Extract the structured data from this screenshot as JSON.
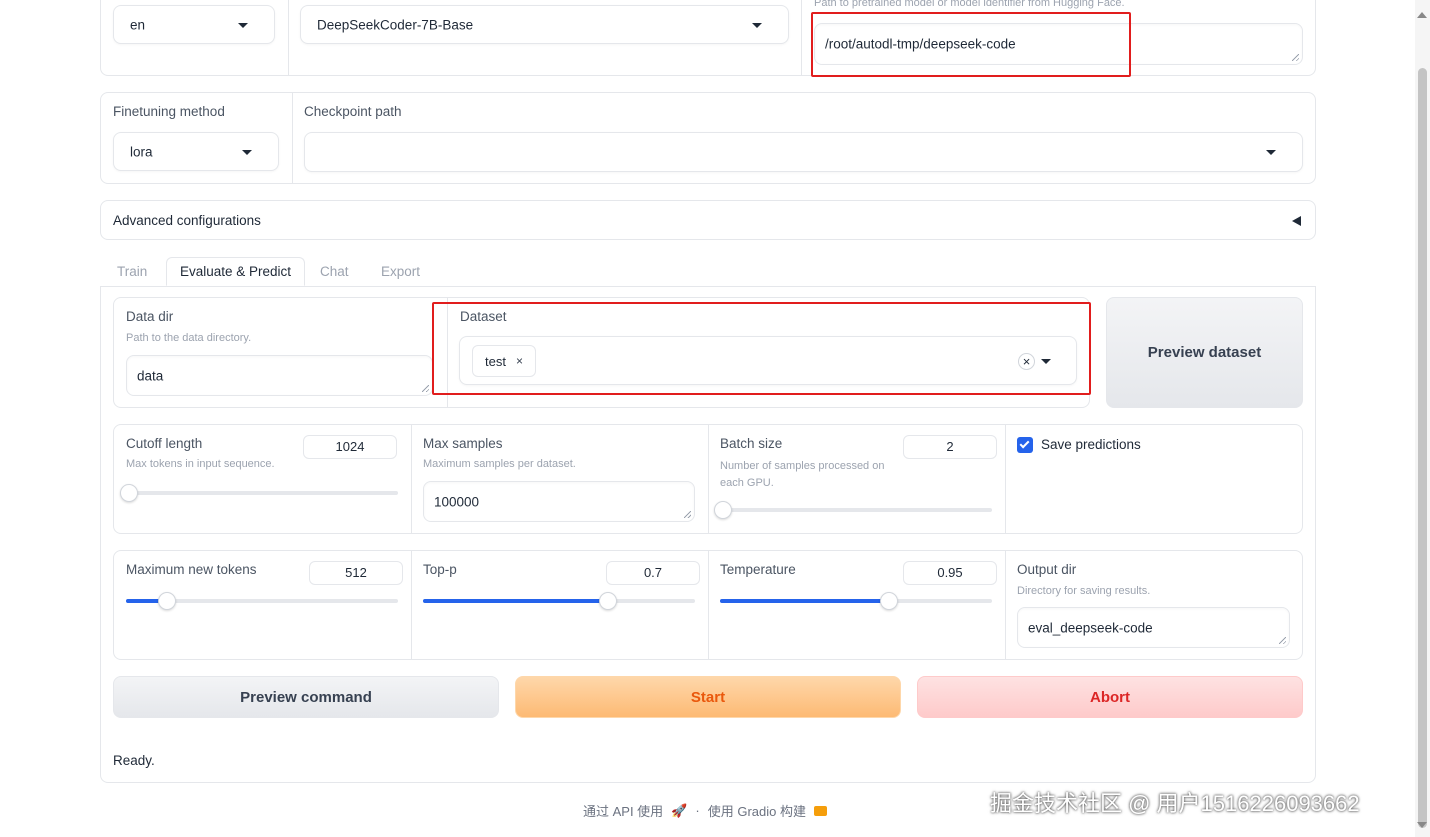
{
  "top_row": {
    "language": "en",
    "model_name": "DeepSeekCoder-7B-Base",
    "model_path_info": "Path to pretrained model or model identifier from Hugging Face.",
    "model_path_value": "/root/autodl-tmp/deepseek-code"
  },
  "finetune_row": {
    "method_label": "Finetuning method",
    "method_value": "lora",
    "checkpoint_label": "Checkpoint path",
    "checkpoint_value": ""
  },
  "advanced": {
    "label": "Advanced configurations"
  },
  "tabs": [
    {
      "label": "Train"
    },
    {
      "label": "Evaluate & Predict"
    },
    {
      "label": "Chat"
    },
    {
      "label": "Export"
    }
  ],
  "data_row": {
    "data_dir_label": "Data dir",
    "data_dir_info": "Path to the data directory.",
    "data_dir_value": "data",
    "dataset_label": "Dataset",
    "dataset_tag": "test",
    "preview_dataset": "Preview dataset"
  },
  "params_row1": {
    "cutoff_label": "Cutoff length",
    "cutoff_info": "Max tokens in input sequence.",
    "cutoff_value": "1024",
    "cutoff_fraction": 0.01,
    "max_samples_label": "Max samples",
    "max_samples_info": "Maximum samples per dataset.",
    "max_samples_value": "100000",
    "batch_label": "Batch size",
    "batch_info": "Number of samples processed on each GPU.",
    "batch_value": "2",
    "batch_fraction": 0.01,
    "save_predictions_label": "Save predictions",
    "save_predictions_checked": true
  },
  "params_row2": {
    "max_new_tokens_label": "Maximum new tokens",
    "max_new_tokens_value": "512",
    "max_new_tokens_fraction": 0.15,
    "top_p_label": "Top-p",
    "top_p_value": "0.7",
    "top_p_fraction": 0.68,
    "temperature_label": "Temperature",
    "temperature_value": "0.95",
    "temperature_fraction": 0.62,
    "output_dir_label": "Output dir",
    "output_dir_info": "Directory for saving results.",
    "output_dir_value": "eval_deepseek-code"
  },
  "actions": {
    "preview_command": "Preview command",
    "start": "Start",
    "abort": "Abort"
  },
  "status": "Ready.",
  "footer": {
    "api": "通过 API 使用",
    "sep": "·",
    "built_with": "使用 Gradio 构建"
  },
  "watermark": "掘金技术社区 @ 用户1516226093662",
  "colors": {
    "accent": "#2563eb",
    "start_text": "#ea580c",
    "abort_text": "#dc2626",
    "annotation_red": "#e11d1d"
  }
}
